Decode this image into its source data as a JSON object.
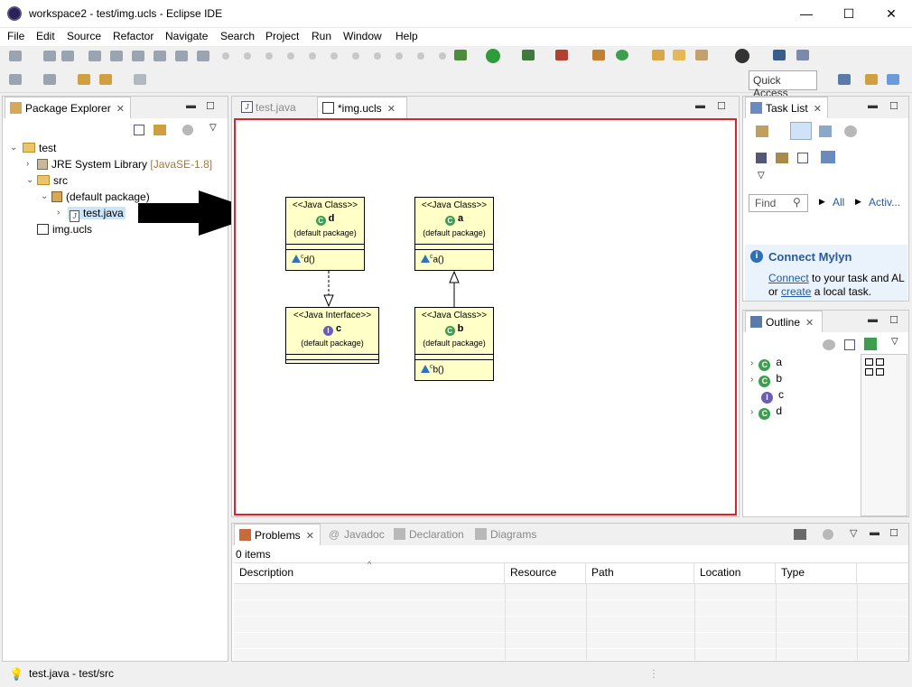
{
  "window": {
    "title": "workspace2 - test/img.ucls - Eclipse IDE",
    "minimize": "—",
    "maximize": "☐",
    "close": "✕"
  },
  "menu": [
    "File",
    "Edit",
    "Source",
    "Refactor",
    "Navigate",
    "Search",
    "Project",
    "Run",
    "Window",
    "Help"
  ],
  "toolbar": {
    "quick_access": "Quick Access"
  },
  "package_explorer": {
    "tab_label": "Package Explorer",
    "tree": {
      "project": "test",
      "jre": "JRE System Library",
      "jre_version": "[JavaSE-1.8]",
      "src": "src",
      "default_package": "(default package)",
      "java_file": "test.java",
      "ucls_file": "img.ucls"
    }
  },
  "editor": {
    "tabs": [
      "test.java",
      "*img.ucls"
    ],
    "classes": {
      "d": {
        "stereotype": "<<Java Class>>",
        "name": "d",
        "package": "(default package)",
        "method": "d()"
      },
      "a": {
        "stereotype": "<<Java Class>>",
        "name": "a",
        "package": "(default package)",
        "method": "a()"
      },
      "c": {
        "stereotype": "<<Java Interface>>",
        "name": "c",
        "package": "(default package)"
      },
      "b": {
        "stereotype": "<<Java Class>>",
        "name": "b",
        "package": "(default package)",
        "method": "b()"
      }
    },
    "method_modifier": "c",
    "highlight_color": "#e0202a"
  },
  "task_list": {
    "tab_label": "Task List",
    "find_placeholder": "Find",
    "all_label": "All",
    "activate_label": "Activ...",
    "mylyn_title": "Connect Mylyn",
    "mylyn_connect_link": "Connect",
    "mylyn_text1": " to your task and AL",
    "mylyn_text2_prefix": "or ",
    "mylyn_create_link": "create",
    "mylyn_text2_suffix": " a local task."
  },
  "outline": {
    "tab_label": "Outline",
    "items": [
      {
        "kind": "C",
        "label": "a"
      },
      {
        "kind": "C",
        "label": "b"
      },
      {
        "kind": "I",
        "label": "c"
      },
      {
        "kind": "C",
        "label": "d"
      }
    ]
  },
  "bottom": {
    "tabs": [
      "Problems",
      "Javadoc",
      "Declaration",
      "Diagrams"
    ],
    "items_count": "0 items",
    "columns": [
      "Description",
      "Resource",
      "Path",
      "Location",
      "Type"
    ]
  },
  "status_bar": {
    "text": "test.java - test/src"
  }
}
